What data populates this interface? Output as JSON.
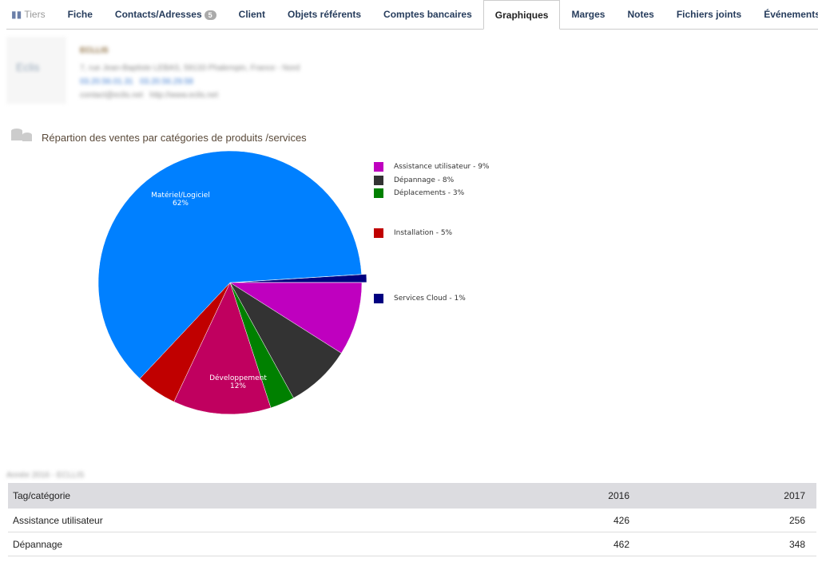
{
  "tabs": [
    {
      "label": "Tiers"
    },
    {
      "label": "Fiche"
    },
    {
      "label": "Contacts/Adresses",
      "badge": "5"
    },
    {
      "label": "Client"
    },
    {
      "label": "Objets référents"
    },
    {
      "label": "Comptes bancaires"
    },
    {
      "label": "Graphiques",
      "active": true
    },
    {
      "label": "Marges"
    },
    {
      "label": "Notes"
    },
    {
      "label": "Fichiers joints"
    },
    {
      "label": "Événements"
    }
  ],
  "company": {
    "name": "ECLLIS",
    "address": "7, rue Jean-Baptiste LEBAS, 59133 Phalempin, France - Nord",
    "phone": "03.20.56.01.31",
    "fax": "03.20.56.29.58",
    "email": "contact@eclis.net",
    "url": "http://www.eclis.net",
    "logo": "Eclis"
  },
  "section_title": "Répartion des ventes par catégories de produits /services",
  "chart_data": {
    "type": "pie",
    "title": "Répartion des ventes par catégories de produits /services",
    "slices": [
      {
        "name": "Services Cloud",
        "value": 1,
        "color": "#000080",
        "legend": "Services Cloud - 1%"
      },
      {
        "name": "Assistance utilisateur",
        "value": 9,
        "color": "#bf00bf",
        "legend": "Assistance utilisateur - 9%"
      },
      {
        "name": "Dépannage",
        "value": 8,
        "color": "#333333",
        "legend": "Dépannage - 8%"
      },
      {
        "name": "Déplacements",
        "value": 3,
        "color": "#008000",
        "legend": "Déplacements - 3%"
      },
      {
        "name": "Développement",
        "value": 12,
        "color": "#c0005f",
        "label": "Développement",
        "pct": "12%"
      },
      {
        "name": "Installation",
        "value": 5,
        "color": "#c00000",
        "legend": "Installation - 5%"
      },
      {
        "name": "Matériel/Logiciel",
        "value": 62,
        "color": "#0080ff",
        "label": "Matériel/Logiciel",
        "pct": "62%"
      }
    ]
  },
  "table": {
    "caption": "Année 2016 - ECLLIS",
    "headers": [
      "Tag/catégorie",
      "2016",
      "2017"
    ],
    "rows": [
      [
        "Assistance utilisateur",
        "426",
        "256"
      ],
      [
        "Dépannage",
        "462",
        "348"
      ]
    ]
  }
}
